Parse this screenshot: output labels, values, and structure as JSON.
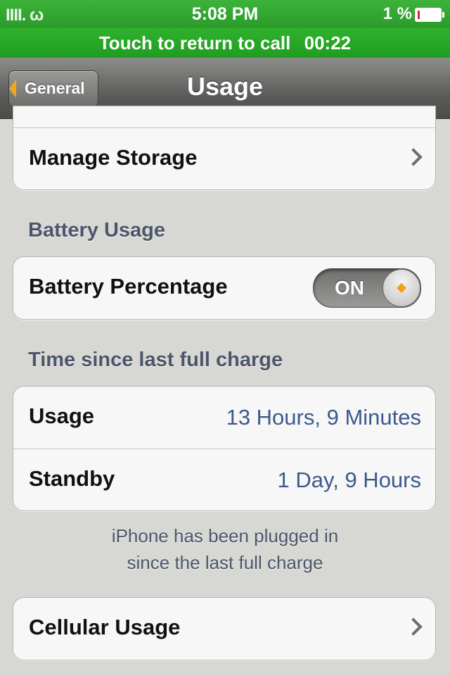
{
  "status_bar": {
    "carrier": "IIII. ω",
    "time": "5:08 PM",
    "battery": "1 %"
  },
  "call_banner": {
    "text": "Touch to return to call",
    "duration": "00:22"
  },
  "nav": {
    "back_label": "General",
    "title": "Usage"
  },
  "storage": {
    "manage_label": "Manage Storage"
  },
  "battery_section": {
    "header": "Battery Usage",
    "percentage_label": "Battery Percentage",
    "toggle_state": "ON"
  },
  "charge_section": {
    "header": "Time since last full charge",
    "rows": [
      {
        "label": "Usage",
        "value": "13 Hours, 9 Minutes"
      },
      {
        "label": "Standby",
        "value": "1 Day, 9 Hours"
      }
    ],
    "footnote_line1": "iPhone has been plugged in",
    "footnote_line2": "since the last full charge"
  },
  "cellular": {
    "label": "Cellular Usage"
  },
  "colors": {
    "status_green": "#2fb12d",
    "value_blue": "#3d5a8b",
    "header_gray": "#4c566a",
    "accent_orange": "#f0a81b"
  }
}
